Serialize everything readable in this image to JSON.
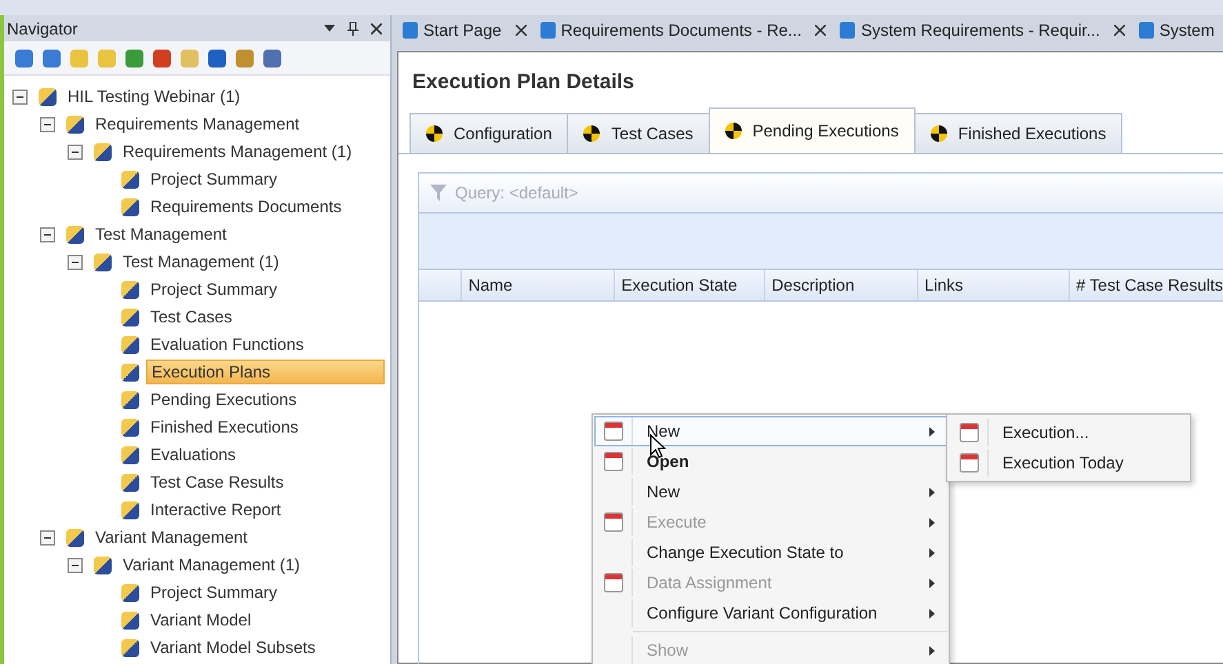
{
  "navigator": {
    "title": "Navigator",
    "tree": [
      {
        "label": "HIL Testing Webinar (1)",
        "expanded": true,
        "selected": false,
        "children": [
          {
            "label": "Requirements Management",
            "expanded": true,
            "selected": false,
            "children": [
              {
                "label": "Requirements Management (1)",
                "expanded": true,
                "selected": false,
                "children": [
                  {
                    "label": "Project Summary",
                    "selected": false
                  },
                  {
                    "label": "Requirements Documents",
                    "selected": false
                  }
                ]
              }
            ]
          },
          {
            "label": "Test Management",
            "expanded": true,
            "selected": false,
            "children": [
              {
                "label": "Test Management  (1)",
                "expanded": true,
                "selected": false,
                "children": [
                  {
                    "label": "Project Summary",
                    "selected": false
                  },
                  {
                    "label": "Test Cases",
                    "selected": false
                  },
                  {
                    "label": "Evaluation Functions",
                    "selected": false
                  },
                  {
                    "label": "Execution Plans",
                    "selected": true
                  },
                  {
                    "label": "Pending Executions",
                    "selected": false
                  },
                  {
                    "label": "Finished Executions",
                    "selected": false
                  },
                  {
                    "label": "Evaluations",
                    "selected": false
                  },
                  {
                    "label": "Test Case Results",
                    "selected": false
                  },
                  {
                    "label": "Interactive Report",
                    "selected": false
                  }
                ]
              }
            ]
          },
          {
            "label": "Variant Management",
            "expanded": true,
            "selected": false,
            "children": [
              {
                "label": "Variant Management (1)",
                "expanded": true,
                "selected": false,
                "children": [
                  {
                    "label": "Project Summary",
                    "selected": false
                  },
                  {
                    "label": "Variant Model",
                    "selected": false
                  },
                  {
                    "label": "Variant Model Subsets",
                    "selected": false
                  }
                ]
              }
            ]
          }
        ]
      }
    ]
  },
  "document_tabs": [
    {
      "label": "Start Page",
      "selected": false,
      "closable": true
    },
    {
      "label": "Requirements Documents - Re...",
      "selected": false,
      "closable": true
    },
    {
      "label": "System Requirements - Requir...",
      "selected": false,
      "closable": true
    },
    {
      "label": "System",
      "selected": false,
      "closable": false
    }
  ],
  "details": {
    "title": "Execution Plan Details",
    "tabs": [
      {
        "label": "Configuration",
        "selected": false
      },
      {
        "label": "Test Cases",
        "selected": false
      },
      {
        "label": "Pending Executions",
        "selected": true
      },
      {
        "label": "Finished Executions",
        "selected": false
      }
    ],
    "query": "Query: <default>",
    "columns": [
      "Name",
      "Execution State",
      "Description",
      "Links",
      "# Test Case Results"
    ]
  },
  "context_menu": {
    "items": [
      {
        "label": "New",
        "has_icon": true,
        "highlighted": true,
        "disabled": false,
        "bold": false,
        "submenu": true
      },
      {
        "label": "Open",
        "has_icon": true,
        "highlighted": false,
        "disabled": false,
        "bold": true,
        "submenu": false
      },
      {
        "label": "New",
        "has_icon": false,
        "highlighted": false,
        "disabled": false,
        "bold": false,
        "submenu": true
      },
      {
        "label": "Execute",
        "has_icon": true,
        "highlighted": false,
        "disabled": true,
        "bold": false,
        "submenu": true
      },
      {
        "label": "Change Execution State to",
        "has_icon": false,
        "highlighted": false,
        "disabled": false,
        "bold": false,
        "submenu": true
      },
      {
        "label": "Data Assignment",
        "has_icon": true,
        "highlighted": false,
        "disabled": true,
        "bold": false,
        "submenu": true
      },
      {
        "label": "Configure Variant Configuration",
        "has_icon": false,
        "highlighted": false,
        "disabled": false,
        "bold": false,
        "submenu": true
      },
      {
        "label": "Show",
        "has_icon": false,
        "highlighted": false,
        "disabled": true,
        "bold": false,
        "submenu": true,
        "separator_before": true
      }
    ],
    "submenu": [
      {
        "label": "Execution..."
      },
      {
        "label": "Execution Today"
      }
    ]
  }
}
